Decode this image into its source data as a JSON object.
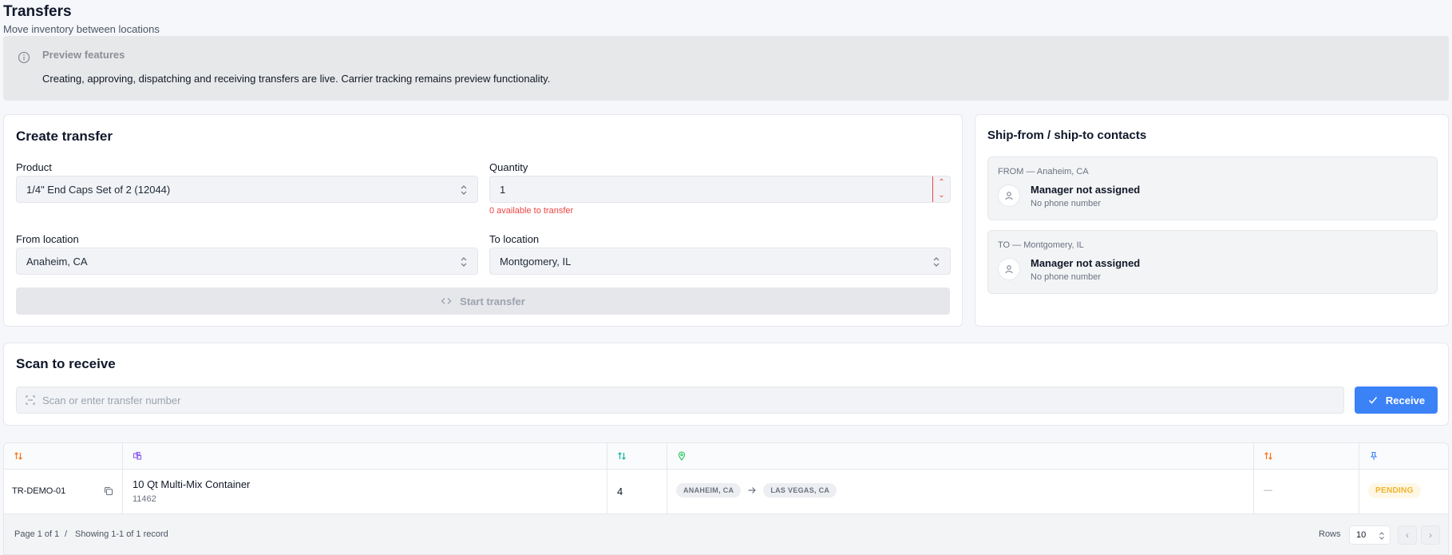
{
  "header": {
    "title": "Transfers",
    "subtitle": "Move inventory between locations"
  },
  "banner": {
    "icon": "info-icon",
    "title": "Preview features",
    "text": "Creating, approving, dispatching and receiving transfers are live. Carrier tracking remains preview functionality."
  },
  "create": {
    "title": "Create transfer",
    "product_label": "Product",
    "product_value": "1/4\" End Caps Set of 2 (12044)",
    "quantity_label": "Quantity",
    "quantity_value": "1",
    "quantity_error": "0 available to transfer",
    "from_label": "From location",
    "from_value": "Anaheim, CA",
    "to_label": "To location",
    "to_value": "Montgomery, IL",
    "start_label": "Start transfer"
  },
  "contacts": {
    "title": "Ship-from / ship-to contacts",
    "from": {
      "header": "FROM — Anaheim, CA",
      "name": "Manager not assigned",
      "phone": "No phone number"
    },
    "to": {
      "header": "TO — Montgomery, IL",
      "name": "Manager not assigned",
      "phone": "No phone number"
    }
  },
  "scan": {
    "title": "Scan to receive",
    "placeholder": "Scan or enter transfer number",
    "receive_label": "Receive"
  },
  "table": {
    "header_icons": [
      "sort-icon",
      "package-icon",
      "sort-icon",
      "location-pin-icon",
      "sort-icon",
      "pin-icon"
    ],
    "row": {
      "transfer_number": "TR-DEMO-01",
      "product_name": "10 Qt Multi-Mix Container",
      "product_sku": "11462",
      "quantity": "4",
      "from": "ANAHEIM, CA",
      "to": "LAS VEGAS, CA",
      "eta": "—",
      "status": "PENDING"
    },
    "footer": {
      "page": "Page 1 of 1",
      "separator": "/",
      "showing": "Showing 1-1 of 1 record",
      "rows_label": "Rows",
      "rows_value": "10"
    }
  },
  "colors": {
    "accent": "#3b82f6",
    "error": "#ef4444",
    "pending": "#f0b429",
    "header_icon_orange": "#f97316",
    "header_icon_purple": "#8b5cf6",
    "header_icon_teal": "#14b8a6",
    "header_icon_green": "#22c55e",
    "header_icon_blue": "#3b82f6"
  }
}
